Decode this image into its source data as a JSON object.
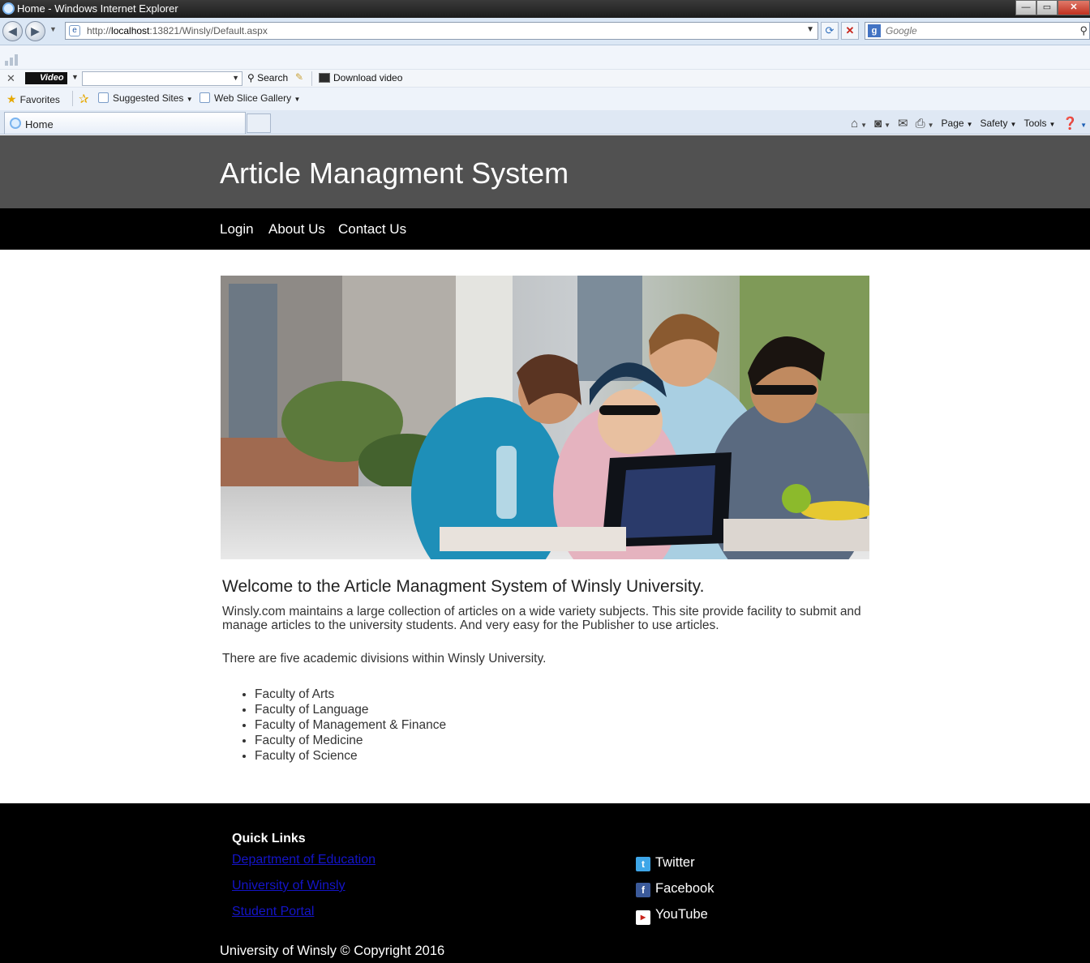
{
  "window": {
    "title": "Home - Windows Internet Explorer",
    "address": "http://localhost:13821/Winsly/Default.aspx",
    "search_placeholder": "Google"
  },
  "video_toolbar": {
    "logo": "Video",
    "search_label": "Search",
    "download_label": "Download video"
  },
  "favorites_bar": {
    "favorites_label": "Favorites",
    "links": [
      "Suggested Sites",
      "Web Slice Gallery"
    ]
  },
  "tab": {
    "label": "Home"
  },
  "command_bar": {
    "items": [
      "Page",
      "Safety",
      "Tools"
    ]
  },
  "site": {
    "title": "Article Managment System",
    "nav": [
      "Login",
      "About Us",
      "Contact Us"
    ]
  },
  "content": {
    "welcome": "Welcome to the Article Managment System of Winsly University.",
    "intro": "Winsly.com maintains a large collection of articles on a wide variety subjects. This site provide facility to submit and manage articles to the university students. And very easy for the Publisher to use articles.",
    "divisions": "There are five academic divisions within Winsly University.",
    "faculties": [
      "Faculty of Arts",
      "Faculty of Language",
      "Faculty of Management & Finance",
      "Faculty of Medicine",
      "Faculty of Science"
    ]
  },
  "footer": {
    "quick_links_title": "Quick Links",
    "quick_links": [
      "Department of Education",
      "University of Winsly",
      "Student Portal"
    ],
    "social": [
      "Twitter",
      "Facebook",
      "YouTube"
    ],
    "copyright": "University of Winsly © Copyright 2016"
  },
  "colors": {
    "header_bg": "#515151",
    "nav_bg": "#000000",
    "footer_bg": "#000000",
    "link_color": "#1414c8"
  }
}
